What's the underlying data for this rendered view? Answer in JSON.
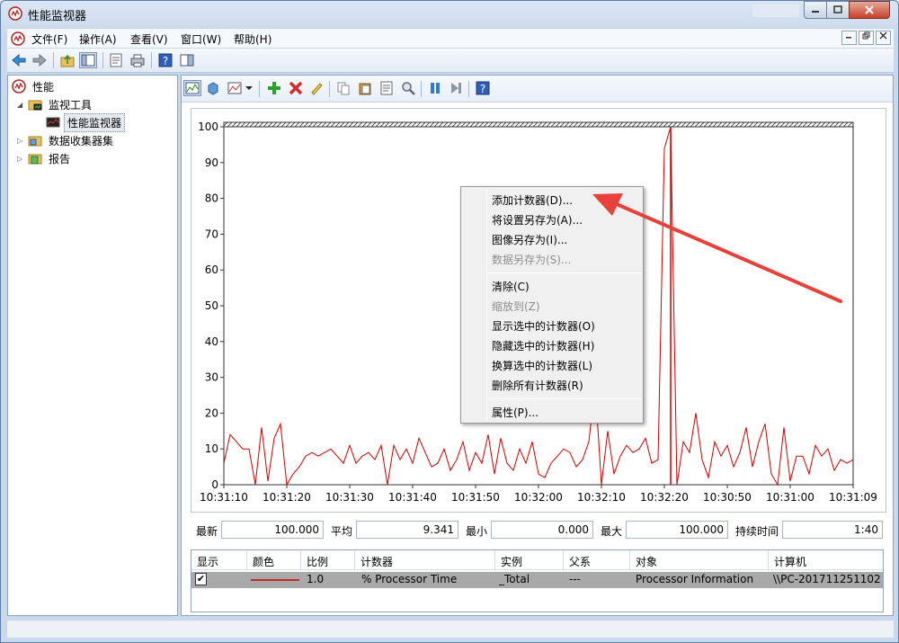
{
  "window": {
    "title": "性能监视器"
  },
  "menubar": {
    "items": [
      "文件(F)",
      "操作(A)",
      "查看(V)",
      "窗口(W)",
      "帮助(H)"
    ]
  },
  "tree": {
    "root": "性能",
    "monitoring_tools": "监视工具",
    "performance_monitor": "性能监视器",
    "data_collector_sets": "数据收集器集",
    "reports": "报告"
  },
  "chart_data": {
    "type": "line",
    "ylim": [
      0,
      100
    ],
    "y_ticks": [
      "0",
      "10",
      "20",
      "30",
      "40",
      "50",
      "60",
      "70",
      "80",
      "90",
      "100"
    ],
    "x_ticks": [
      "10:31:10",
      "10:31:20",
      "10:31:30",
      "10:31:40",
      "10:31:50",
      "10:32:00",
      "10:32:10",
      "10:32:20",
      "10:30:50",
      "10:31:00",
      "10:31:09"
    ],
    "series": [
      {
        "color": "#cc0000",
        "values": [
          6,
          14,
          12,
          10,
          10,
          0,
          16,
          1,
          13,
          17,
          0,
          3,
          5,
          8,
          9,
          8,
          9,
          10,
          8,
          6,
          11,
          6,
          8,
          9,
          7,
          11,
          0,
          11,
          7,
          10,
          6,
          13,
          9,
          5,
          6,
          10,
          4,
          7,
          12,
          4,
          9,
          6,
          14,
          3,
          13,
          6,
          4,
          10,
          6,
          12,
          3,
          2,
          6,
          8,
          10,
          9,
          5,
          7,
          12,
          28,
          0,
          15,
          3,
          8,
          11,
          9,
          10,
          13,
          6,
          7,
          94,
          100,
          0,
          12,
          9,
          20,
          7,
          2,
          12,
          8,
          11,
          5,
          9,
          16,
          5,
          12,
          17,
          3,
          0,
          16,
          1,
          8,
          8,
          3,
          11,
          8,
          10,
          4,
          7,
          6,
          7
        ]
      }
    ]
  },
  "stats": {
    "last_label": "最新",
    "last_value": "100.000",
    "avg_label": "平均",
    "avg_value": "9.341",
    "min_label": "最小",
    "min_value": "0.000",
    "max_label": "最大",
    "max_value": "100.000",
    "duration_label": "持续时间",
    "duration_value": "1:40"
  },
  "legend": {
    "headers": [
      "显示",
      "颜色",
      "比例",
      "计数器",
      "实例",
      "父系",
      "对象",
      "计算机"
    ],
    "row": {
      "show": "✔",
      "scale": "1.0",
      "counter": "% Processor Time",
      "instance": "_Total",
      "parent": "---",
      "object": "Processor Information",
      "computer": "\\\\PC-201711251102"
    }
  },
  "context_menu": {
    "add_counters": "添加计数器(D)...",
    "save_settings_as": "将设置另存为(A)...",
    "save_image_as": "图像另存为(I)...",
    "save_data_as": "数据另存为(S)...",
    "clear": "清除(C)",
    "zoom_to": "缩放到(Z)",
    "show_selected": "显示选中的计数器(O)",
    "hide_selected": "隐藏选中的计数器(H)",
    "scale_selected": "换算选中的计数器(L)",
    "remove_all": "删除所有计数器(R)",
    "properties": "属性(P)..."
  },
  "colors": {
    "accent_red": "#e8413a",
    "series_red": "#cc0000",
    "legend_row_bg": "#a9a9a9"
  }
}
